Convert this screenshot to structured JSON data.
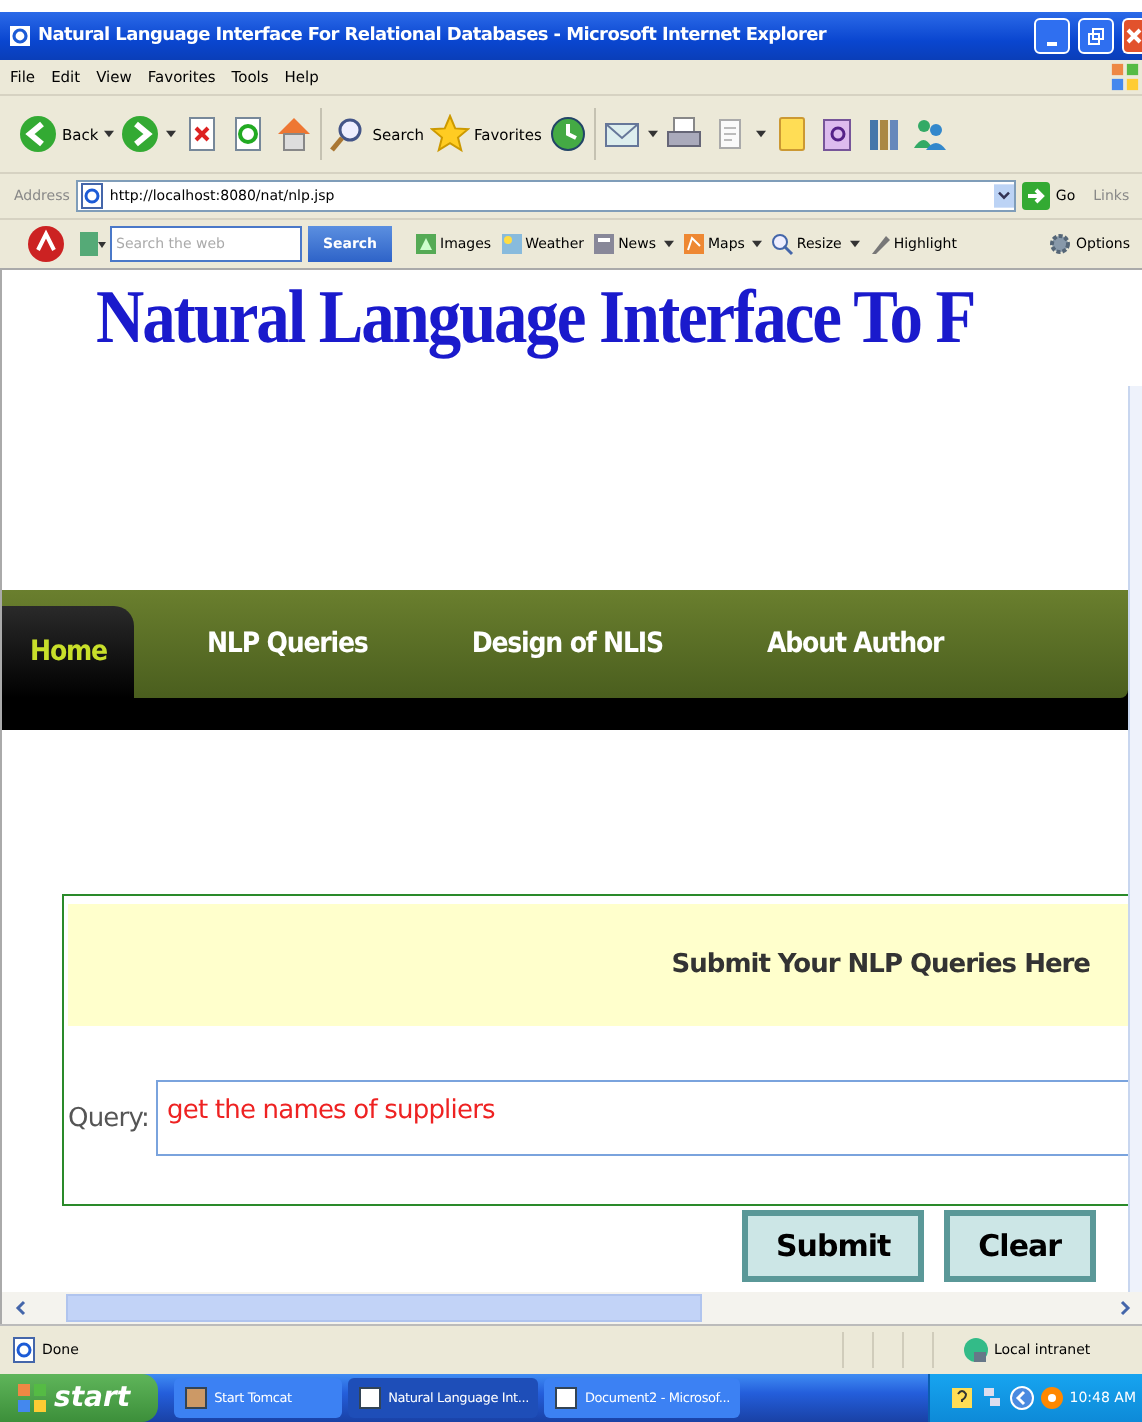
{
  "window": {
    "title": "Natural Language Interface For Relational Databases - Microsoft Internet Explorer"
  },
  "menu": [
    "File",
    "Edit",
    "View",
    "Favorites",
    "Tools",
    "Help"
  ],
  "toolbar": {
    "back": "Back",
    "search": "Search",
    "favorites": "Favorites"
  },
  "address": {
    "label": "Address",
    "url": "http://localhost:8080/nat/nlp.jsp",
    "go": "Go",
    "links": "Links"
  },
  "ask_toolbar": {
    "placeholder": "Search the web",
    "search": "Search",
    "items": [
      "Images",
      "Weather",
      "News",
      "Maps",
      "Resize",
      "Highlight"
    ],
    "options": "Options"
  },
  "page": {
    "heading": "Natural Language Interface To F",
    "nav": [
      {
        "label": "Home",
        "selected": true
      },
      {
        "label": "NLP Queries",
        "selected": false
      },
      {
        "label": "Design of NLIS",
        "selected": false
      },
      {
        "label": "About Author",
        "selected": false
      }
    ],
    "panel_title": "Submit Your NLP Queries Here",
    "query_label": "Query:",
    "query_value": "get the names of suppliers",
    "buttons": [
      "Submit",
      "Clear"
    ]
  },
  "status_bar": {
    "status": "Done",
    "zone": "Local intranet"
  },
  "taskbar": {
    "start": "start",
    "tasks": [
      {
        "label": "Start Tomcat",
        "selected": false
      },
      {
        "label": "Natural Language Int...",
        "selected": true
      },
      {
        "label": "Document2 - Microsof...",
        "selected": false
      }
    ],
    "clock": "10:48 AM"
  }
}
